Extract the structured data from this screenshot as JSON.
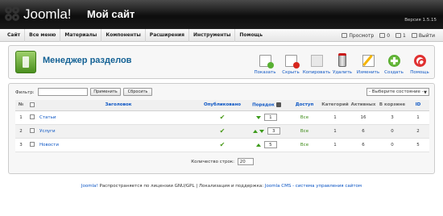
{
  "header": {
    "logo_text": "Joomla!",
    "site_title": "Мой сайт",
    "version": "Версия 1.5.15"
  },
  "menu": {
    "items": [
      "Сайт",
      "Все меню",
      "Материалы",
      "Компоненты",
      "Расширения",
      "Инструменты",
      "Помощь"
    ]
  },
  "status": {
    "preview": "Просмотр",
    "messages": "0",
    "users": "1",
    "logout": "Выйти"
  },
  "toolbar": {
    "title": "Менеджер разделов",
    "buttons": [
      {
        "label": "Показать",
        "icon": "publish-icon"
      },
      {
        "label": "Скрыть",
        "icon": "unpublish-icon"
      },
      {
        "label": "Копировать",
        "icon": "copy-icon"
      },
      {
        "label": "Удалить",
        "icon": "delete-icon"
      },
      {
        "label": "Изменить",
        "icon": "edit-icon"
      },
      {
        "label": "Создать",
        "icon": "new-icon"
      },
      {
        "label": "Помощь",
        "icon": "help-icon"
      }
    ]
  },
  "filter": {
    "label": "Фильтр:",
    "value": "",
    "apply_label": "Применить",
    "reset_label": "Сбросить",
    "state_select": "- Выберите состояние -"
  },
  "table": {
    "columns": [
      "№",
      "",
      "Заголовок",
      "Опубликовано",
      "Порядок",
      "Доступ",
      "Категорий",
      "Активных",
      "В корзине",
      "ID"
    ],
    "rows": [
      {
        "num": "1",
        "title": "Статьи",
        "published": true,
        "order": "1",
        "access": "Все",
        "categories": "1",
        "active": "16",
        "trash": "3",
        "id": "1"
      },
      {
        "num": "2",
        "title": "Услуги",
        "published": true,
        "order": "3",
        "access": "Все",
        "categories": "1",
        "active": "6",
        "trash": "0",
        "id": "2"
      },
      {
        "num": "3",
        "title": "Новости",
        "published": true,
        "order": "5",
        "access": "Все",
        "categories": "1",
        "active": "6",
        "trash": "0",
        "id": "5"
      }
    ]
  },
  "pager": {
    "label": "Количество строк:",
    "value": "20"
  },
  "footer": {
    "link1": "Joomla!",
    "text": " Распространяется по лицензии GNU/GPL | Локализация и поддержка: ",
    "link2": "Joomla CMS - система управления сайтом"
  }
}
